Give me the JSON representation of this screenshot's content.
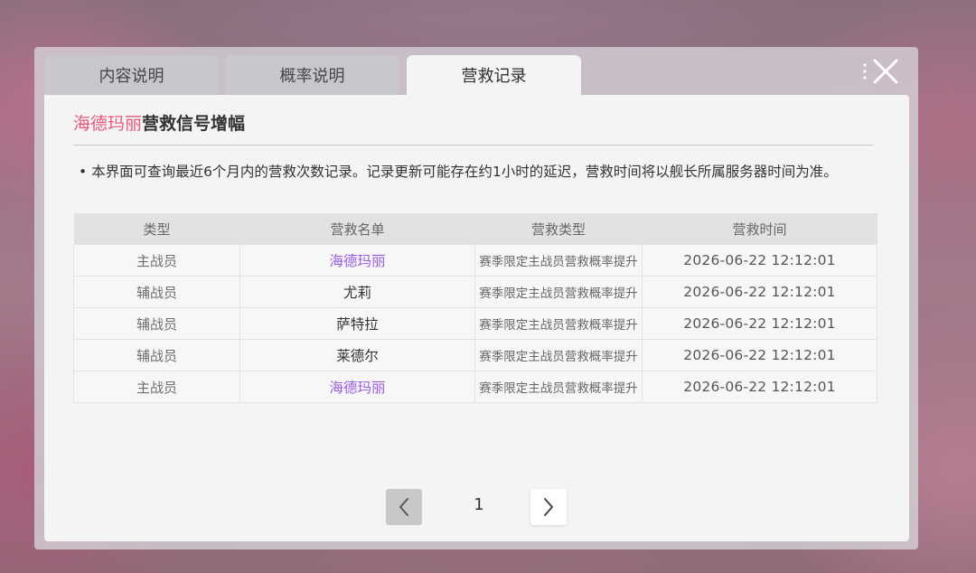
{
  "tabs": [
    {
      "label": "内容说明",
      "active": false
    },
    {
      "label": "概率说明",
      "active": false
    },
    {
      "label": "营救记录",
      "active": true
    }
  ],
  "title": {
    "accent": "海德玛丽",
    "rest": "营救信号增幅"
  },
  "notice": "• 本界面可查询最近6个月内的营救次数记录。记录更新可能存在约1小时的延迟，营救时间将以舰长所属服务器时间为准。",
  "table": {
    "headers": [
      "类型",
      "营救名单",
      "营救类型",
      "营救时间"
    ],
    "rows": [
      {
        "type": "主战员",
        "name": "海德玛丽",
        "rescue_type": "赛季限定主战员营救概率提升",
        "time": "2026-06-22 12:12:01"
      },
      {
        "type": "辅战员",
        "name": "尤莉",
        "rescue_type": "赛季限定主战员营救概率提升",
        "time": "2026-06-22 12:12:01"
      },
      {
        "type": "辅战员",
        "name": "萨特拉",
        "rescue_type": "赛季限定主战员营救概率提升",
        "time": "2026-06-22 12:12:01"
      },
      {
        "type": "辅战员",
        "name": "莱德尔",
        "rescue_type": "赛季限定主战员营救概率提升",
        "time": "2026-06-22 12:12:01"
      },
      {
        "type": "主战员",
        "name": "海德玛丽",
        "rescue_type": "赛季限定主战员营救概率提升",
        "time": "2026-06-22 12:12:01"
      }
    ]
  },
  "pagination": {
    "current_page": "1"
  },
  "icons": {
    "close": "close-icon",
    "prev": "chevron-left-icon",
    "next": "chevron-right-icon"
  },
  "colors": {
    "accent_pink": "#e8587b",
    "highlight_purple": "#9b5de0"
  }
}
